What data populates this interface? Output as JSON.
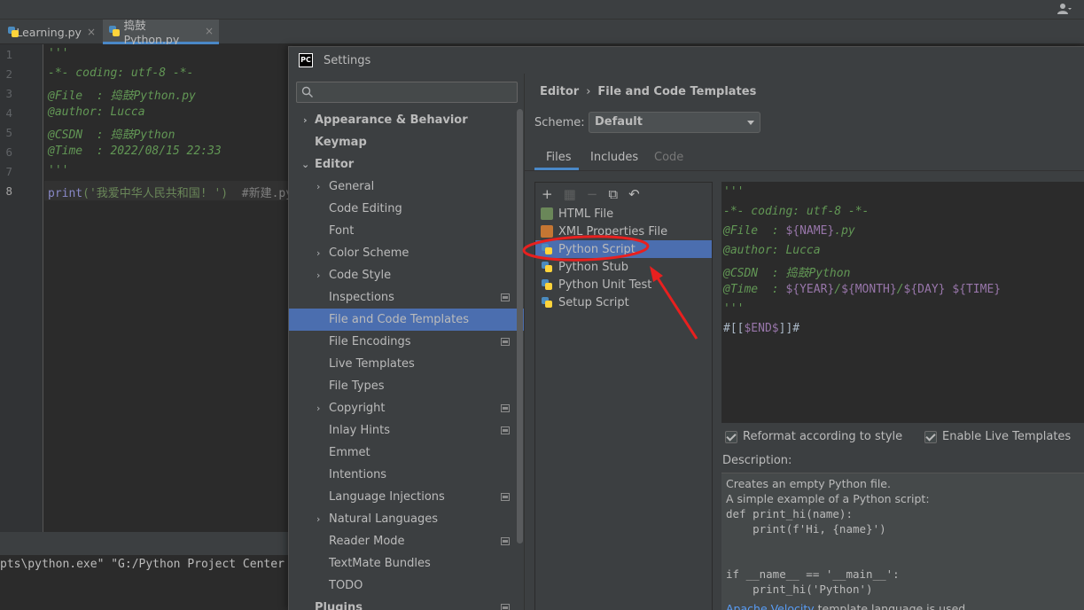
{
  "ide": {
    "tabs": [
      {
        "label": "Learning.py",
        "close": "×"
      },
      {
        "label": "捣鼓Python.py",
        "close": "×"
      }
    ],
    "line_numbers": [
      "1",
      "2",
      "3",
      "4",
      "5",
      "6",
      "7",
      "8"
    ],
    "code_lines": [
      "'''",
      "-*- coding: utf-8 -*-",
      "@File  : 捣鼓Python.py",
      "@author: Lucca",
      "@CSDN  : 捣鼓Python",
      "@Time  : 2022/08/15 22:33",
      "'''",
      "print",
      "('我爱中华人民共和国! ')",
      "  #新建.py"
    ],
    "run_output": "pts\\python.exe\" \"G:/Python Project Center"
  },
  "dialog": {
    "title": "Settings",
    "icon_text": "PC",
    "search_placeholder": "",
    "tree": [
      {
        "label": "Appearance & Behavior",
        "chevron": "›"
      },
      {
        "label": "Keymap"
      },
      {
        "label": "Editor",
        "chevron": "⌄"
      },
      {
        "label": "General",
        "chevron": "›"
      },
      {
        "label": "Code Editing"
      },
      {
        "label": "Font"
      },
      {
        "label": "Color Scheme",
        "chevron": "›"
      },
      {
        "label": "Code Style",
        "chevron": "›"
      },
      {
        "label": "Inspections"
      },
      {
        "label": "File and Code Templates"
      },
      {
        "label": "File Encodings"
      },
      {
        "label": "Live Templates"
      },
      {
        "label": "File Types"
      },
      {
        "label": "Copyright",
        "chevron": "›"
      },
      {
        "label": "Inlay Hints"
      },
      {
        "label": "Emmet"
      },
      {
        "label": "Intentions"
      },
      {
        "label": "Language Injections"
      },
      {
        "label": "Natural Languages",
        "chevron": "›"
      },
      {
        "label": "Reader Mode"
      },
      {
        "label": "TextMate Bundles"
      },
      {
        "label": "TODO"
      },
      {
        "label": "Plugins"
      }
    ],
    "breadcrumb": [
      "Editor",
      "File and Code Templates"
    ],
    "breadcrumb_sep": "›",
    "scheme_label": "Scheme:",
    "scheme_value": "Default",
    "subtabs": [
      "Files",
      "Includes",
      "Code"
    ],
    "toolbar": {
      "add": "+",
      "copy_template": "▦",
      "remove": "−",
      "duplicate": "⧉",
      "reset": "↶"
    },
    "files": [
      {
        "label": "HTML File",
        "icon": "html-file-icon"
      },
      {
        "label": "XML Properties File",
        "icon": "xml-file-icon"
      },
      {
        "label": "Python Script",
        "icon": "python-file-icon"
      },
      {
        "label": "Python Stub",
        "icon": "python-file-icon"
      },
      {
        "label": "Python Unit Test",
        "icon": "python-file-icon"
      },
      {
        "label": "Setup Script",
        "icon": "python-file-icon"
      }
    ],
    "template_code": {
      "l1": "'''",
      "l2": "-*- coding: utf-8 -*-",
      "l3a": "@File  : ",
      "l3b": "${NAME}",
      "l3c": ".py",
      "l4": "@author: Lucca",
      "l5": "@CSDN  : 捣鼓Python",
      "l6a": "@Time  : ",
      "l6b": "${YEAR}",
      "l6c": "/",
      "l6d": "${MONTH}",
      "l6e": "/",
      "l6f": "${DAY}",
      "l6g": " ",
      "l6h": "${TIME}",
      "l7": "'''",
      "l8a": "#[[",
      "l8b": "$END$",
      "l8c": "]]#"
    },
    "reformat_label": "Reformat according to style",
    "live_templates_label": "Enable Live Templates",
    "description_label": "Description:",
    "description": {
      "l1": "Creates an empty Python file.",
      "l2": "A simple example of a Python script:",
      "l3": "def print_hi(name):",
      "l4": "    print(f'Hi, {name}')",
      "l5": "if __name__ == '__main__':",
      "l6": "    print_hi('Python')",
      "l7a": "Apache Velocity",
      "l7b": " template language is used"
    }
  },
  "colors": {
    "accent": "#4b6eaf",
    "annotation": "#e8201f"
  }
}
